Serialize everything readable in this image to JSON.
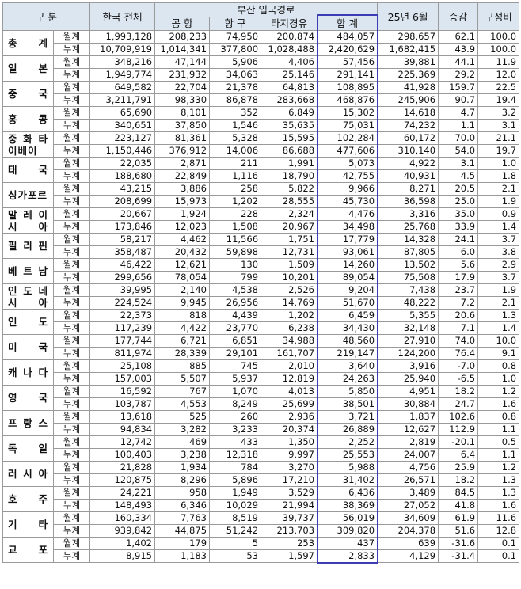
{
  "header": {
    "division": "구        분",
    "korea_total": "한국 전체",
    "busan_group": "부산 입국경로",
    "airport": "공  항",
    "seaport": "항  구",
    "via_other": "타지경유",
    "sum": "합  계",
    "prev_year": "25년 6월",
    "change": "증감",
    "share": "구성비"
  },
  "row_types": {
    "month": "월계",
    "cumulative": "누계"
  },
  "countries": [
    {
      "name": "총       계",
      "month": [
        "1,993,128",
        "208,233",
        "74,950",
        "200,874",
        "484,057",
        "298,657",
        "62.1",
        "100.0"
      ],
      "cumulative": [
        "10,709,919",
        "1,014,341",
        "377,800",
        "1,028,488",
        "2,420,629",
        "1,682,415",
        "43.9",
        "100.0"
      ]
    },
    {
      "name": "일       본",
      "month": [
        "348,216",
        "47,144",
        "5,906",
        "4,406",
        "57,456",
        "39,881",
        "44.1",
        "11.9"
      ],
      "cumulative": [
        "1,949,774",
        "231,932",
        "34,063",
        "25,146",
        "291,141",
        "225,369",
        "29.2",
        "12.0"
      ]
    },
    {
      "name": "중       국",
      "month": [
        "649,582",
        "22,704",
        "21,378",
        "64,813",
        "108,895",
        "41,928",
        "159.7",
        "22.5"
      ],
      "cumulative": [
        "3,211,791",
        "98,330",
        "86,878",
        "283,668",
        "468,876",
        "245,906",
        "90.7",
        "19.4"
      ]
    },
    {
      "name": "홍       콩",
      "month": [
        "65,690",
        "8,101",
        "352",
        "6,849",
        "15,302",
        "14,618",
        "4.7",
        "3.2"
      ],
      "cumulative": [
        "340,651",
        "37,850",
        "1,546",
        "35,635",
        "75,031",
        "74,232",
        "1.1",
        "3.1"
      ]
    },
    {
      "name": "중   화 타이베이",
      "two": true,
      "month": [
        "223,127",
        "81,361",
        "5,328",
        "15,595",
        "102,284",
        "60,172",
        "70.0",
        "21.1"
      ],
      "cumulative": [
        "1,150,446",
        "376,912",
        "14,006",
        "86,688",
        "477,606",
        "310,140",
        "54.0",
        "19.7"
      ]
    },
    {
      "name": "태       국",
      "month": [
        "22,035",
        "2,871",
        "211",
        "1,991",
        "5,073",
        "4,922",
        "3.1",
        "1.0"
      ],
      "cumulative": [
        "188,680",
        "22,849",
        "1,116",
        "18,790",
        "42,755",
        "40,931",
        "4.5",
        "1.8"
      ]
    },
    {
      "name": "싱가포르",
      "month": [
        "43,215",
        "3,886",
        "258",
        "5,822",
        "9,966",
        "8,271",
        "20.5",
        "2.1"
      ],
      "cumulative": [
        "208,699",
        "15,973",
        "1,202",
        "28,555",
        "45,730",
        "36,598",
        "25.0",
        "1.9"
      ]
    },
    {
      "name": "말 레 이 시   아",
      "two": true,
      "month": [
        "20,667",
        "1,924",
        "228",
        "2,324",
        "4,476",
        "3,316",
        "35.0",
        "0.9"
      ],
      "cumulative": [
        "173,846",
        "12,023",
        "1,508",
        "20,967",
        "34,498",
        "25,768",
        "33.9",
        "1.4"
      ]
    },
    {
      "name": "필 리 핀",
      "month": [
        "58,217",
        "4,462",
        "11,566",
        "1,751",
        "17,779",
        "14,328",
        "24.1",
        "3.7"
      ],
      "cumulative": [
        "358,487",
        "20,432",
        "59,898",
        "12,731",
        "93,061",
        "87,805",
        "6.0",
        "3.8"
      ]
    },
    {
      "name": "베 트 남",
      "month": [
        "46,422",
        "12,621",
        "130",
        "1,509",
        "14,260",
        "13,502",
        "5.6",
        "2.9"
      ],
      "cumulative": [
        "299,656",
        "78,054",
        "799",
        "10,201",
        "89,054",
        "75,508",
        "17.9",
        "3.7"
      ]
    },
    {
      "name": "인       도 네 시 아",
      "two": true,
      "month": [
        "39,995",
        "2,140",
        "4,538",
        "2,526",
        "9,204",
        "7,438",
        "23.7",
        "1.9"
      ],
      "cumulative": [
        "224,524",
        "9,945",
        "26,956",
        "14,769",
        "51,670",
        "48,222",
        "7.2",
        "2.1"
      ]
    },
    {
      "name": "인       도",
      "month": [
        "22,373",
        "818",
        "4,439",
        "1,202",
        "6,459",
        "5,355",
        "20.6",
        "1.3"
      ],
      "cumulative": [
        "117,239",
        "4,422",
        "23,770",
        "6,238",
        "34,430",
        "32,148",
        "7.1",
        "1.4"
      ]
    },
    {
      "name": "미       국",
      "month": [
        "177,744",
        "6,721",
        "6,851",
        "34,988",
        "48,560",
        "27,910",
        "74.0",
        "10.0"
      ],
      "cumulative": [
        "811,974",
        "28,339",
        "29,101",
        "161,707",
        "219,147",
        "124,200",
        "76.4",
        "9.1"
      ]
    },
    {
      "name": "캐 나 다",
      "month": [
        "25,108",
        "885",
        "745",
        "2,010",
        "3,640",
        "3,916",
        "-7.0",
        "0.8"
      ],
      "cumulative": [
        "157,003",
        "5,507",
        "5,937",
        "12,819",
        "24,263",
        "25,940",
        "-6.5",
        "1.0"
      ]
    },
    {
      "name": "영       국",
      "month": [
        "16,592",
        "767",
        "1,070",
        "4,013",
        "5,850",
        "4,951",
        "18.2",
        "1.2"
      ],
      "cumulative": [
        "103,787",
        "4,553",
        "8,249",
        "25,699",
        "38,501",
        "30,884",
        "24.7",
        "1.6"
      ]
    },
    {
      "name": "프 랑 스",
      "month": [
        "13,618",
        "525",
        "260",
        "2,936",
        "3,721",
        "1,837",
        "102.6",
        "0.8"
      ],
      "cumulative": [
        "94,834",
        "3,282",
        "3,233",
        "20,374",
        "26,889",
        "12,627",
        "112.9",
        "1.1"
      ]
    },
    {
      "name": "독       일",
      "month": [
        "12,742",
        "469",
        "433",
        "1,350",
        "2,252",
        "2,819",
        "-20.1",
        "0.5"
      ],
      "cumulative": [
        "100,403",
        "3,238",
        "12,318",
        "9,997",
        "25,553",
        "24,007",
        "6.4",
        "1.1"
      ]
    },
    {
      "name": "러 시 아",
      "month": [
        "21,828",
        "1,934",
        "784",
        "3,270",
        "5,988",
        "4,756",
        "25.9",
        "1.2"
      ],
      "cumulative": [
        "120,875",
        "8,296",
        "5,896",
        "17,210",
        "31,402",
        "26,571",
        "18.2",
        "1.3"
      ]
    },
    {
      "name": "호       주",
      "month": [
        "24,221",
        "958",
        "1,949",
        "3,529",
        "6,436",
        "3,489",
        "84.5",
        "1.3"
      ],
      "cumulative": [
        "148,493",
        "6,346",
        "10,029",
        "21,994",
        "38,369",
        "27,052",
        "41.8",
        "1.6"
      ]
    },
    {
      "name": "기       타",
      "month": [
        "160,334",
        "7,763",
        "8,519",
        "39,737",
        "56,019",
        "34,609",
        "61.9",
        "11.6"
      ],
      "cumulative": [
        "939,842",
        "44,875",
        "51,242",
        "213,703",
        "309,820",
        "204,378",
        "51.6",
        "12.8"
      ]
    },
    {
      "name": "교       포",
      "month": [
        "1,402",
        "179",
        "5",
        "253",
        "437",
        "639",
        "-31.6",
        "0.1"
      ],
      "cumulative": [
        "8,915",
        "1,183",
        "53",
        "1,597",
        "2,833",
        "4,129",
        "-31.4",
        "0.1"
      ]
    }
  ]
}
